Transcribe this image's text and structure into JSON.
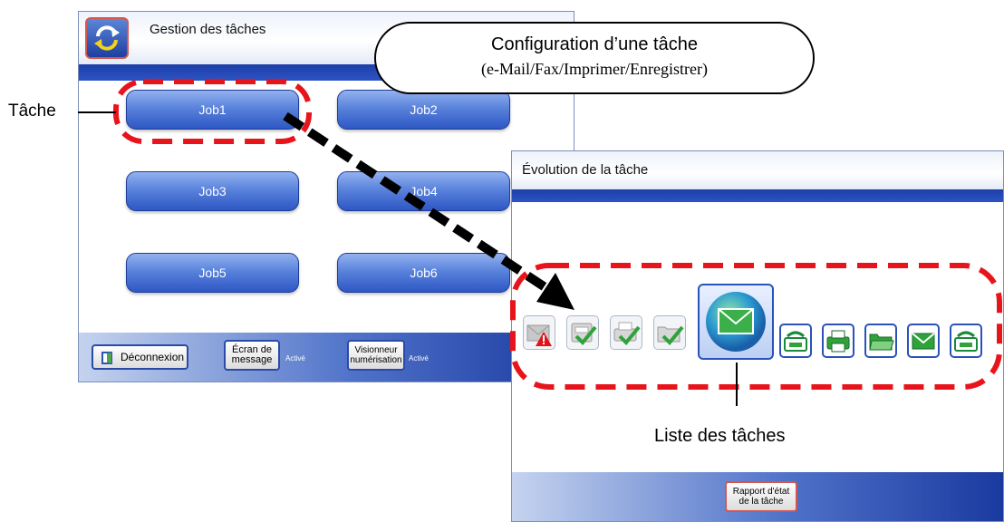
{
  "task_manager": {
    "title": "Gestion des tâches",
    "jobs": [
      "Job1",
      "Job2",
      "Job3",
      "Job4",
      "Job5",
      "Job6"
    ],
    "footer": {
      "logout": "Déconnexion",
      "message_screen_line1": "Écran de",
      "message_screen_line2": "message",
      "message_screen_status": "Activé",
      "scan_viewer_line1": "Visionneur",
      "scan_viewer_line2": "numérisation",
      "scan_viewer_status": "Activé"
    }
  },
  "task_progress": {
    "title": "Évolution de la tâche",
    "icons": [
      "mail-error-icon",
      "fax-done-icon",
      "print-done-icon",
      "save-done-icon",
      "email-globe-icon",
      "fax-icon",
      "printer-icon",
      "folder-icon",
      "email-icon",
      "fax-icon"
    ],
    "report_button_line1": "Rapport d'état",
    "report_button_line2": "de la tâche"
  },
  "annotations": {
    "job_config_line1": "Configuration d’une tâche",
    "job_config_line2": "(e-Mail/Fax/Imprimer/Enregistrer)",
    "job_label": "Tâche",
    "job_list_label": "Liste des tâches"
  },
  "colors": {
    "accent_blue": "#2e57c5",
    "highlight_red": "#e8141c",
    "success_green": "#2fa33a"
  }
}
